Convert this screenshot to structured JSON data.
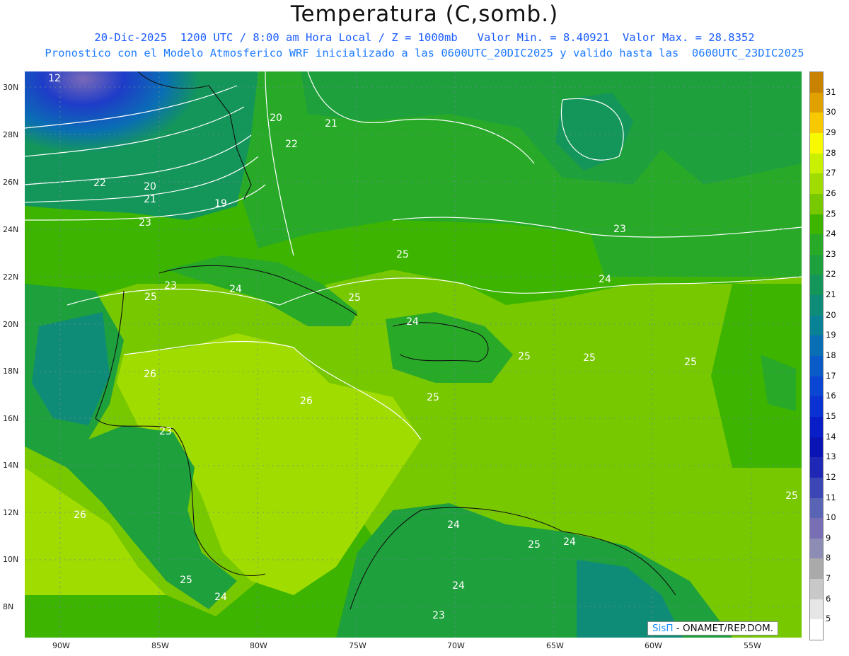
{
  "header": {
    "title": "Temperatura (C,somb.)",
    "line1": "20-Dic-2025  1200 UTC / 8:00 am Hora Local / Z = 1000mb   Valor Min. = 8.40921  Valor Max. = 28.8352",
    "line2": "Pronostico con el Modelo Atmosferico WRF inicializado a las 0600UTC_20DIC2025 y valido hasta las  0600UTC_23DIC2025"
  },
  "axes": {
    "lat_labels": [
      "30N",
      "28N",
      "26N",
      "24N",
      "22N",
      "20N",
      "18N",
      "16N",
      "14N",
      "12N",
      "10N",
      "8N"
    ],
    "lon_labels": [
      "90W",
      "85W",
      "80W",
      "75W",
      "70W",
      "65W",
      "60W",
      "55W"
    ]
  },
  "colorbar": {
    "labels": [
      "31",
      "30",
      "29",
      "28",
      "27",
      "26",
      "25",
      "24",
      "23",
      "22",
      "21",
      "20",
      "19",
      "18",
      "17",
      "16",
      "15",
      "14",
      "13",
      "12",
      "11",
      "10",
      "9",
      "8",
      "7",
      "6",
      "5"
    ],
    "colors": [
      "#c88200",
      "#e0a000",
      "#f8c800",
      "#f8f800",
      "#c8f000",
      "#a0dc00",
      "#78c800",
      "#3cb400",
      "#28aa28",
      "#1ea03c",
      "#14965a",
      "#0f8c78",
      "#0a8296",
      "#0a6eb4",
      "#0a5ac8",
      "#0a46d2",
      "#0a32d2",
      "#0a1ec8",
      "#0a14b4",
      "#1e28b4",
      "#3c46b4",
      "#5a64b4",
      "#786eb4",
      "#8c8cb4",
      "#aaaaaa",
      "#c8c8c8",
      "#e6e6e6",
      "#ffffff"
    ]
  },
  "contour_labels": [
    "12",
    "20",
    "21",
    "22",
    "23",
    "19",
    "23",
    "22",
    "20",
    "21",
    "24",
    "25",
    "23",
    "24",
    "25",
    "24",
    "26",
    "26",
    "25",
    "25",
    "25",
    "25",
    "23",
    "26",
    "25",
    "24",
    "24",
    "25",
    "24",
    "23",
    "24",
    "25",
    "25"
  ],
  "credit": {
    "brand": "SisΠ",
    "text": " - ONAMET/REP.DOM."
  }
}
